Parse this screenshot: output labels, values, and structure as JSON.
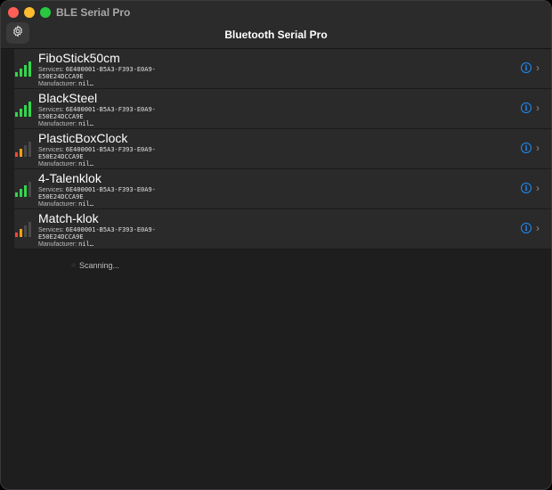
{
  "app": {
    "window_title": "BLE Serial Pro",
    "header_title": "Bluetooth Serial Pro"
  },
  "labels": {
    "services": "Services:",
    "manufacturer": "Manufacturer:"
  },
  "devices": [
    {
      "name": "FiboStick50cm",
      "services_line1": "6E400001-B5A3-F393-E0A9-",
      "services_line2": "E50E24DCCA9E",
      "manufacturer": "nil…",
      "signal_level": 4
    },
    {
      "name": "BlackSteel",
      "services_line1": "6E400001-B5A3-F393-E0A9-",
      "services_line2": "E50E24DCCA9E",
      "manufacturer": "nil…",
      "signal_level": 4
    },
    {
      "name": "PlasticBoxClock",
      "services_line1": "6E400001-B5A3-F393-E0A9-",
      "services_line2": "E50E24DCCA9E",
      "manufacturer": "nil…",
      "signal_level": 2
    },
    {
      "name": "4-Talenklok",
      "services_line1": "6E400001-B5A3-F393-E0A9-",
      "services_line2": "E50E24DCCA9E",
      "manufacturer": "nil…",
      "signal_level": 3
    },
    {
      "name": "Match-klok",
      "services_line1": "6E400001-B5A3-F393-E0A9-",
      "services_line2": "E50E24DCCA9E",
      "manufacturer": "nil…",
      "signal_level": 2
    }
  ],
  "status": {
    "text": "Scanning..."
  },
  "icons": {
    "settings": "gear-icon",
    "info": "info-circle-icon",
    "disclosure": "chevron-right-icon",
    "signal": "signal-strength-icon"
  },
  "colors": {
    "accent": "#1e8cff",
    "signal_green": "#32d74b",
    "signal_orange": "#ff9f0a",
    "signal_red": "#ff453a"
  }
}
